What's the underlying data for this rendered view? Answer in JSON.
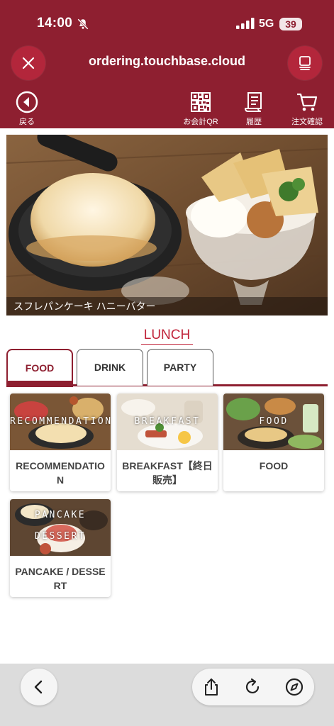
{
  "status_bar": {
    "time": "14:00",
    "network": "5G",
    "battery": "39",
    "icons": [
      "bell-slash-icon",
      "signal-icon"
    ]
  },
  "browser": {
    "url": "ordering.touchbase.cloud",
    "icons": [
      "close-icon",
      "tabs-icon"
    ]
  },
  "nav": {
    "back_label": "戻る",
    "qr_label": "お会計QR",
    "history_label": "履歴",
    "cart_label": "注文確認"
  },
  "hero": {
    "caption": "スフレパンケーキ ハニーバター"
  },
  "menu": {
    "title": "LUNCH",
    "tabs": [
      {
        "label": "FOOD",
        "active": true
      },
      {
        "label": "DRINK",
        "active": false
      },
      {
        "label": "PARTY",
        "active": false
      }
    ],
    "categories": [
      {
        "name": "RECOMMENDATION",
        "overlay": "RECOMMENDATION"
      },
      {
        "name": "BREAKFAST【終日販売】",
        "overlay": "BREAKFAST"
      },
      {
        "name": "FOOD",
        "overlay": "FOOD"
      },
      {
        "name": "PANCAKE / DESSERT",
        "overlay_line1": "PANCAKE",
        "overlay_line2": "DESSERT"
      }
    ]
  },
  "bottom_bar": {
    "icons": [
      "chevron-left-icon",
      "share-icon",
      "reload-icon",
      "compass-icon"
    ]
  },
  "colors": {
    "brand": "#8e1f30",
    "accent_text": "#c0243a",
    "button": "#b3263b"
  }
}
